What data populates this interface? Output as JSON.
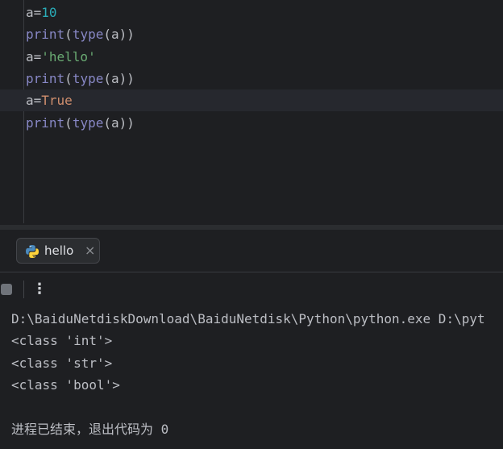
{
  "editor": {
    "lines": [
      [
        {
          "t": "a=",
          "c": "plain"
        },
        {
          "t": "10",
          "c": "num"
        }
      ],
      [
        {
          "t": "print",
          "c": "builtin"
        },
        {
          "t": "(",
          "c": "plain"
        },
        {
          "t": "type",
          "c": "builtin"
        },
        {
          "t": "(a))",
          "c": "plain"
        }
      ],
      [
        {
          "t": "a=",
          "c": "plain"
        },
        {
          "t": "'hello'",
          "c": "str"
        }
      ],
      [
        {
          "t": "print",
          "c": "builtin"
        },
        {
          "t": "(",
          "c": "plain"
        },
        {
          "t": "type",
          "c": "builtin"
        },
        {
          "t": "(a))",
          "c": "plain"
        }
      ],
      [
        {
          "t": "a=",
          "c": "plain"
        },
        {
          "t": "True",
          "c": "kw"
        }
      ],
      [
        {
          "t": "print",
          "c": "builtin"
        },
        {
          "t": "(",
          "c": "plain"
        },
        {
          "t": "type",
          "c": "builtin"
        },
        {
          "t": "(a))",
          "c": "plain"
        }
      ]
    ],
    "current_line": 5
  },
  "run_panel": {
    "tab_label": "hello",
    "tab_close_glyph": "×",
    "tab_icon": "python-icon",
    "stop_icon": "stop-icon",
    "more_glyph": "⋮"
  },
  "console": {
    "lines": [
      "D:\\BaiduNetdiskDownload\\BaiduNetdisk\\Python\\python.exe D:\\pyt",
      "<class 'int'>",
      "<class 'str'>",
      "<class 'bool'>",
      "",
      "进程已结束，退出代码为 0"
    ]
  },
  "colors": {
    "plain": "#bcbec4",
    "num": "#2aacb8",
    "str": "#6aab73",
    "kw": "#cf8e6d",
    "builtin": "#8888c6"
  }
}
